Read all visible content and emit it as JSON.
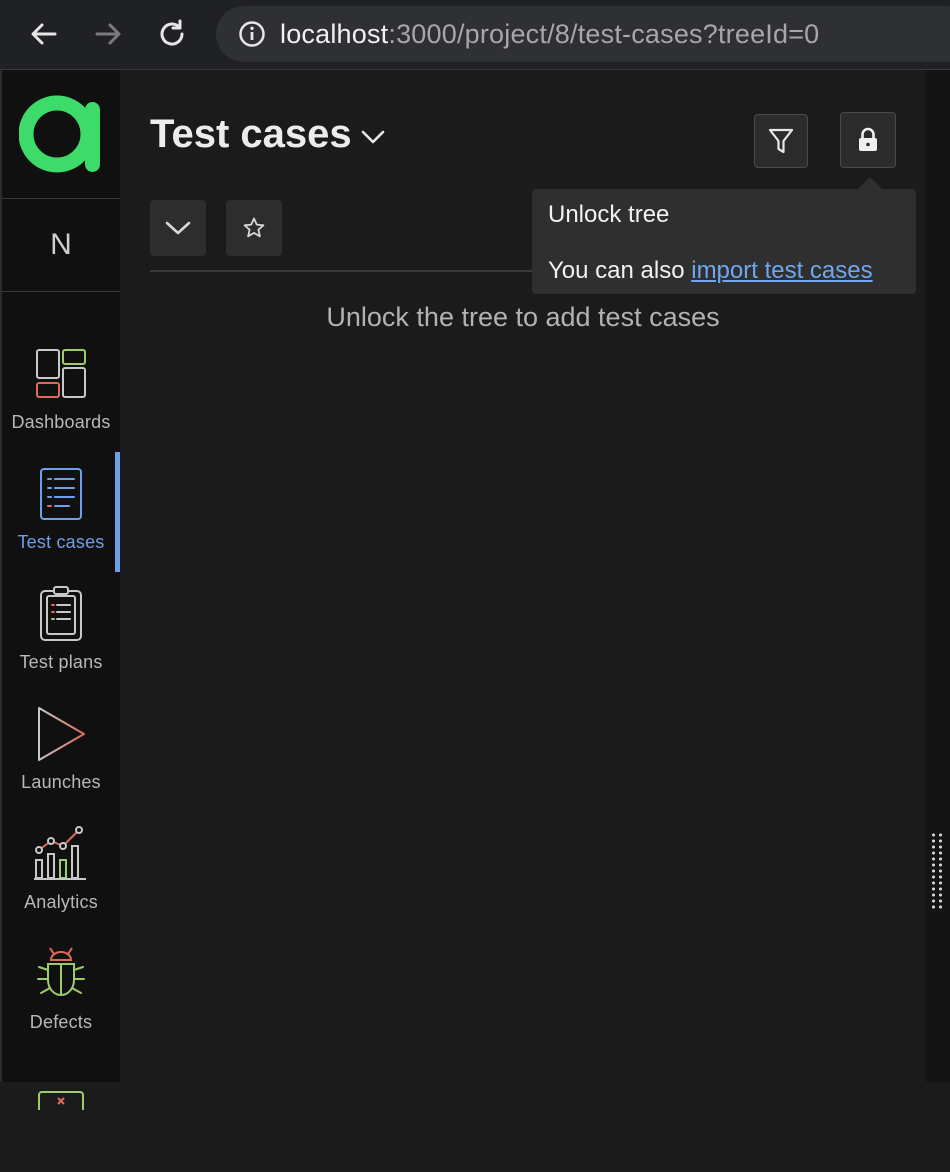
{
  "browser": {
    "url_host": "localhost",
    "url_path": ":3000/project/8/test-cases?treeId=0"
  },
  "sidebar": {
    "project_initial": "N",
    "items": [
      {
        "label": "Dashboards",
        "icon": "dashboards-icon"
      },
      {
        "label": "Test cases",
        "icon": "test-cases-icon",
        "active": true
      },
      {
        "label": "Test plans",
        "icon": "test-plans-icon"
      },
      {
        "label": "Launches",
        "icon": "launches-icon"
      },
      {
        "label": "Analytics",
        "icon": "analytics-icon"
      },
      {
        "label": "Defects",
        "icon": "defects-icon"
      }
    ]
  },
  "main": {
    "title": "Test cases",
    "empty_message": "Unlock the tree to add test cases"
  },
  "tooltip": {
    "title": "Unlock tree",
    "text": "You can also",
    "link": "import test cases"
  },
  "colors": {
    "accent": "#6f9fe8",
    "logo_green": "#3ddc6a",
    "link": "#6ea7ef"
  }
}
